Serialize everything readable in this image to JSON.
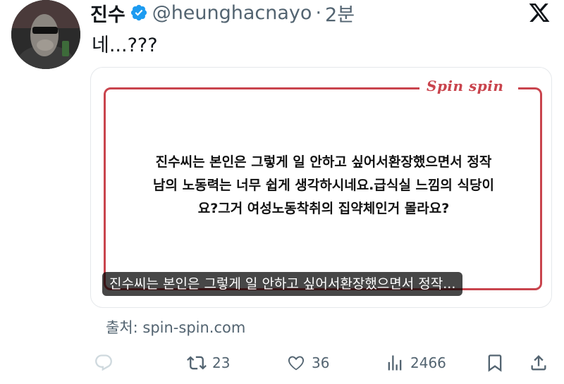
{
  "tweet": {
    "author_name": "진수",
    "handle": "@heunghacnayo",
    "separator": "·",
    "time": "2분",
    "text": "네...???"
  },
  "card": {
    "brand": "Spin spin",
    "quote_lines": [
      "진수씨는 본인은 그렇게 일 안하고 싶어서환장했으면서 정작",
      "남의 노동력는 너무 쉽게 생각하시네요.급식실 느낌의 식당이",
      "요?그거 여성노동착취의 집약체인거 몰라요?"
    ],
    "alt_caption": "진수씨는 본인은 그렇게 일 안하고 싶어서환장했으면서 정작..."
  },
  "source": "출처: spin-spin.com",
  "actions": {
    "reply_count": "",
    "retweet_count": "23",
    "like_count": "36",
    "views_count": "2466"
  },
  "icons": [
    "avatar",
    "verified-badge-icon",
    "x-logo-icon",
    "reply-icon",
    "retweet-icon",
    "like-icon",
    "views-icon",
    "bookmark-icon",
    "share-icon"
  ],
  "colors": {
    "verified": "#1d9bf0",
    "brand_red": "#c9444d",
    "muted": "#536471",
    "text": "#0f1419"
  }
}
